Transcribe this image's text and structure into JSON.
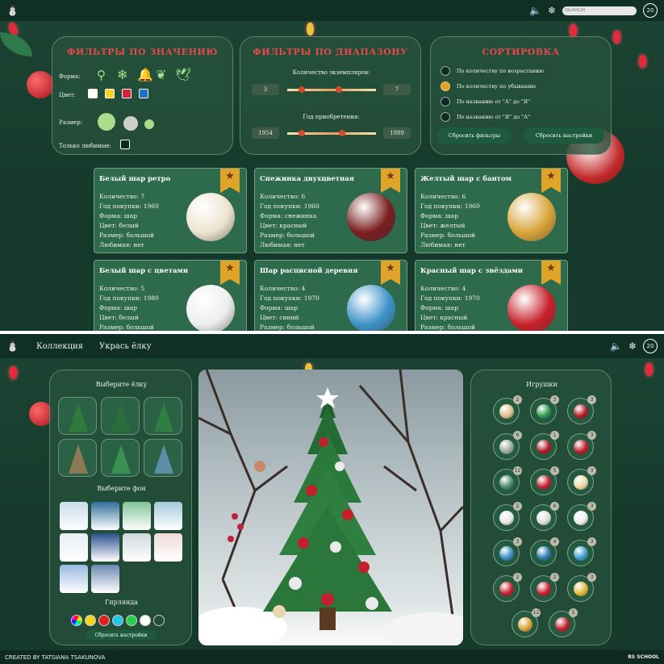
{
  "screen1": {
    "header": {
      "search_placeholder": "SEARCH",
      "counter": "20"
    },
    "filters_value": {
      "title": "ФИЛЬТРЫ ПО ЗНАЧЕНИЮ",
      "shape_label": "Форма:",
      "color_label": "Цвет:",
      "size_label": "Размер:",
      "favorite_label": "Только любимые:",
      "colors": [
        "#ffffff",
        "#f4d51f",
        "#d3223a",
        "#1f74c9"
      ]
    },
    "filters_range": {
      "title": "ФИЛЬТРЫ ПО ДИАПАЗОНУ",
      "count_label": "Количество экземпляров:",
      "count_min": "3",
      "count_max": "7",
      "year_label": "Год приобретения:",
      "year_min": "1954",
      "year_max": "1989"
    },
    "sort": {
      "title": "СОРТИРОВКА",
      "options": [
        "По количеству по возрастанию",
        "По количеству по убыванию",
        "По названию от \"А\" до \"Я\"",
        "По названию от \"Я\" до \"А\""
      ],
      "selected": 1,
      "reset_filters": "Сбросить фильтры",
      "reset_settings": "Сбросить настройки"
    },
    "cards": [
      {
        "title": "Белый шар ретро",
        "qty": "Количество: 7",
        "year": "Год покупки: 1960",
        "shape": "Форма: шар",
        "color": "Цвет: белый",
        "size": "Размер: большой",
        "fav": "Любимая: нет",
        "ball": "#ece4cf"
      },
      {
        "title": "Снежинка двухцветная",
        "qty": "Количество: 6",
        "year": "Год покупки: 1960",
        "shape": "Форма: снежинка",
        "color": "Цвет: красный",
        "size": "Размер: большой",
        "fav": "Любимая: нет",
        "ball": "#7a1f1f"
      },
      {
        "title": "Желтый шар с бантом",
        "qty": "Количество: 6",
        "year": "Год покупки: 1960",
        "shape": "Форма: шар",
        "color": "Цвет: желтый",
        "size": "Размер: большой",
        "fav": "Любимая: нет",
        "ball": "#d9a53a"
      },
      {
        "title": "Белый шар с цветами",
        "qty": "Количество: 5",
        "year": "Год покупки: 1980",
        "shape": "Форма: шар",
        "color": "Цвет: белый",
        "size": "Размер: большой",
        "fav": "",
        "ball": "#eeeeee"
      },
      {
        "title": "Шар расписной деревня",
        "qty": "Количество: 4",
        "year": "Год покупки: 1970",
        "shape": "Форма: шар",
        "color": "Цвет: синий",
        "size": "Размер: большой",
        "fav": "",
        "ball": "#3d93c9"
      },
      {
        "title": "Красный шар с звёздами",
        "qty": "Количество: 4",
        "year": "Год покупки: 1970",
        "shape": "Форма: шар",
        "color": "Цвет: красный",
        "size": "Размер: большой",
        "fav": "",
        "ball": "#c8202a"
      }
    ]
  },
  "screen2": {
    "nav": {
      "collection": "Коллекция",
      "decorate": "Укрась ёлку",
      "counter": "20"
    },
    "left": {
      "choose_tree": "Выберите ёлку",
      "choose_bg": "Выберите фон",
      "garland": "Гирлянда",
      "reset": "Сбросить настройки",
      "garland_colors": [
        "multi",
        "#f4d51f",
        "#e02020",
        "#22c4e8",
        "#22d24a",
        "#ffffff",
        "none"
      ]
    },
    "toys": {
      "title": "Игрушки",
      "counts": [
        "2",
        "3",
        "3",
        "6",
        "1",
        "3",
        "12",
        "5",
        "3",
        "2",
        "6",
        "3",
        "3",
        "4",
        "3",
        "2",
        "2",
        "3",
        "12",
        "5"
      ],
      "colors": [
        "#d8c08a",
        "#2e9a52",
        "#b01c28",
        "#9aaa9a",
        "#b01c28",
        "#c3202c",
        "#4a8a6a",
        "#c3202c",
        "#e8d9a0",
        "#e8e8e8",
        "#dcdcdc",
        "#ececec",
        "#3b8cc0",
        "#2f7bb0",
        "#3f9ccf",
        "#c3202c",
        "#c3202c",
        "#e3b63a",
        "#d9a53a",
        "#c3202c"
      ]
    },
    "footer": {
      "credit": "CREATED BY TATSIANA TSAKUNOVA",
      "logo": "RS SCHOOL"
    }
  }
}
